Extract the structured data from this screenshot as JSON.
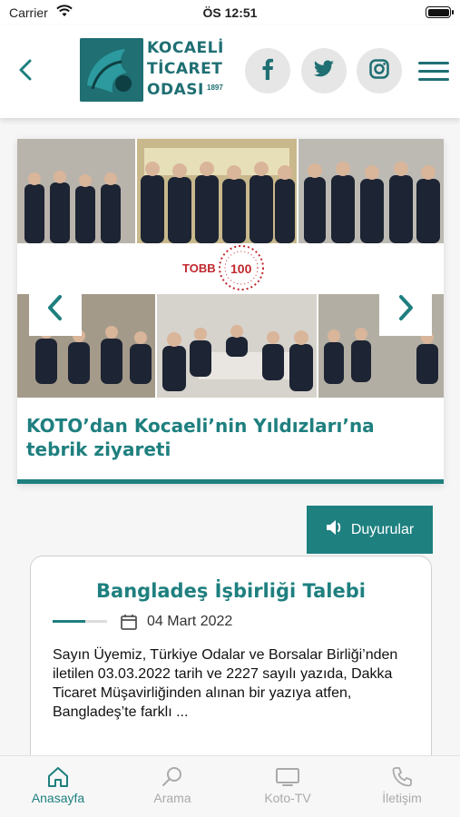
{
  "status_bar": {
    "carrier": "Carrier",
    "time": "ÖS 12:51"
  },
  "header": {
    "logo_lines": [
      "KOCAELİ",
      "TİCARET",
      "ODASI"
    ],
    "logo_year": "1897",
    "social": [
      "facebook-icon",
      "twitter-icon",
      "instagram-icon"
    ]
  },
  "slider": {
    "badge": "TOBB",
    "badge_number": "100",
    "title": "KOTO’dan Kocaeli’nin Yıldızları’na tebrik ziyareti"
  },
  "announcements_button": "Duyurular",
  "news": {
    "title": "Bangladeş İşbirliği Talebi",
    "date": "04 Mart 2022",
    "body": "Sayın Üyemiz, Türkiye Odalar ve Borsalar Birliği’nden iletilen 03.03.2022 tarih ve 2227 sayılı yazıda, Dakka Ticaret Müşavirliğinden alınan bir yazıya atfen, Bangladeş’te farklı ..."
  },
  "tabs": [
    {
      "label": "Anasayfa",
      "icon": "home-icon",
      "active": true
    },
    {
      "label": "Arama",
      "icon": "search-icon",
      "active": false
    },
    {
      "label": "Koto-TV",
      "icon": "tv-icon",
      "active": false
    },
    {
      "label": "İletişim",
      "icon": "phone-icon",
      "active": false
    }
  ],
  "colors": {
    "brand": "#1f7f7f"
  }
}
